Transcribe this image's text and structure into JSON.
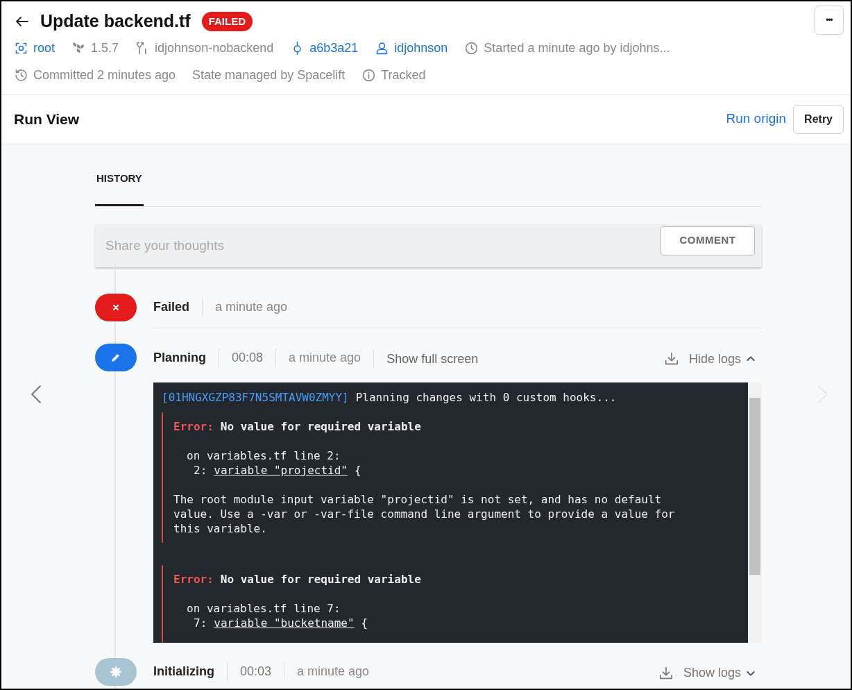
{
  "header": {
    "title": "Update backend.tf",
    "status": "FAILED",
    "menu": "•••",
    "meta_rows": [
      [
        {
          "kind": "link",
          "text": "root"
        },
        {
          "kind": "text",
          "text": "1.5.7"
        },
        {
          "kind": "text",
          "text": "idjohnson-nobackend"
        },
        {
          "kind": "link",
          "text": "a6b3a21"
        },
        {
          "kind": "link",
          "text": "idjohnson"
        },
        {
          "kind": "text",
          "text": "Started a minute ago by idjohns..."
        }
      ],
      [
        {
          "kind": "text",
          "text": "Committed 2 minutes ago"
        },
        {
          "kind": "text",
          "text": "State managed by Spacelift"
        },
        {
          "kind": "text",
          "text": "Tracked"
        }
      ]
    ]
  },
  "toolbar": {
    "title": "Run View",
    "link": "Run origin",
    "button": "Retry"
  },
  "tabs": [
    {
      "label": "HISTORY",
      "selected": true
    }
  ],
  "comment": {
    "placeholder": "Share your thoughts",
    "button": "COMMENT"
  },
  "timeline": [
    {
      "kind": "failed",
      "label": "Failed",
      "time": "a minute ago"
    },
    {
      "kind": "planning",
      "label": "Planning",
      "duration": "00:08",
      "time": "a minute ago",
      "full_screen": "Show full screen",
      "logs_toggle": "Hide logs",
      "expanded": true,
      "log": {
        "run_id": "[01HNGXGZP83F7N5SMTAVW0ZMYY]",
        "message": "Planning changes with 0 custom hooks...",
        "errors": [
          {
            "prefix": "Error:",
            "title": "No value for required variable",
            "location": "on variables.tf line 2:",
            "line_no": "2:",
            "code": "variable \"projectid\"",
            "code_tail": "{",
            "description": "The root module input variable \"projectid\" is not set, and has no default\nvalue. Use a -var or -var-file command line argument to provide a value for\nthis variable."
          },
          {
            "prefix": "Error:",
            "title": "No value for required variable",
            "location": "on variables.tf line 7:",
            "line_no": "7:",
            "code": "variable \"bucketname\"",
            "code_tail": "{"
          }
        ]
      }
    },
    {
      "kind": "initializing",
      "label": "Initializing",
      "duration": "00:03",
      "time": "a minute ago",
      "logs_toggle": "Show logs",
      "expanded": false
    }
  ]
}
